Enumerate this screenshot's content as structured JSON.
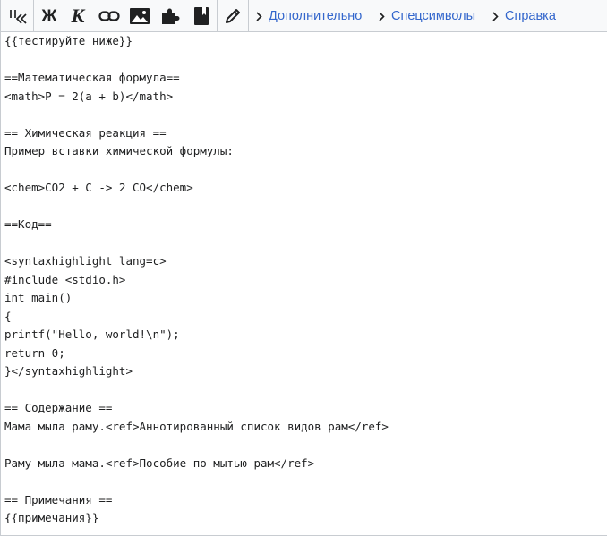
{
  "toolbar": {
    "buttons": [
      {
        "name": "advanced-toggle-button",
        "icon": "signature-icon"
      },
      {
        "name": "bold-button",
        "icon": "bold-icon",
        "glyph": "Ж"
      },
      {
        "name": "italic-button",
        "icon": "italic-icon",
        "glyph": "К"
      },
      {
        "name": "link-button",
        "icon": "link-icon"
      },
      {
        "name": "embed-image-button",
        "icon": "image-icon"
      },
      {
        "name": "insert-reference-button",
        "icon": "puzzle-icon"
      },
      {
        "name": "insert-citation-button",
        "icon": "book-icon"
      },
      {
        "name": "edit-button",
        "icon": "pencil-icon"
      }
    ],
    "tabs": [
      {
        "label": "Дополнительно"
      },
      {
        "label": "Спецсимволы"
      },
      {
        "label": "Справка"
      }
    ],
    "link_color": "#3366cc"
  },
  "editor": {
    "lines": [
      "{{тестируйте ниже}}",
      "",
      "==Математическая формула==",
      "<math>P = 2(a + b)</math>",
      "",
      "== Химическая реакция ==",
      "Пример вставки химической формулы:",
      "",
      "<chem>CO2 + C -> 2 CO</chem>",
      "",
      "==Код==",
      "",
      "<syntaxhighlight lang=c>",
      "#include <stdio.h>",
      "int main()",
      "{",
      "printf(\"Hello, world!\\n\");",
      "return 0;",
      "}</syntaxhighlight>",
      "",
      "== Содержание ==",
      "Мама мыла раму.<ref>Аннотированный список видов рам</ref>",
      "",
      "Раму мыла мама.<ref>Пособие по мытью рам</ref>",
      "",
      "== Примечания ==",
      "{{примечания}}"
    ]
  }
}
